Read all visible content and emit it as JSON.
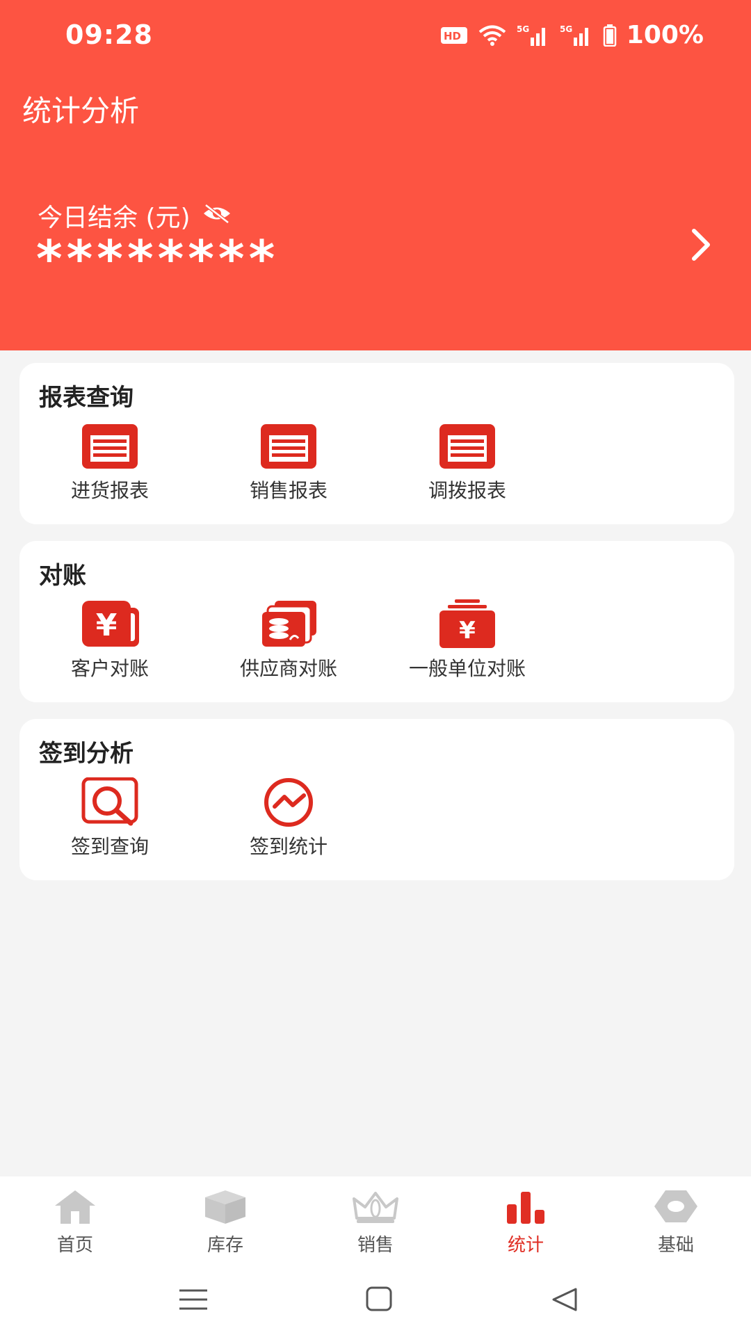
{
  "status": {
    "time": "09:28",
    "battery": "100%",
    "hd": "HD",
    "net1": "5G",
    "net2": "5G"
  },
  "header": {
    "title": "统计分析",
    "balance_label": "今日结余 (元)",
    "balance_value": "********"
  },
  "reports": {
    "title": "报表查询",
    "items": [
      {
        "label": "进货报表",
        "icon": "report-icon"
      },
      {
        "label": "销售报表",
        "icon": "report-icon"
      },
      {
        "label": "调拨报表",
        "icon": "report-icon"
      }
    ]
  },
  "reconcile": {
    "title": "对账",
    "items": [
      {
        "label": "客户对账",
        "icon": "yen-wallet-icon"
      },
      {
        "label": "供应商对账",
        "icon": "coins-icon"
      },
      {
        "label": "一般单位对账",
        "icon": "yen-stack-icon"
      }
    ]
  },
  "checkin": {
    "title": "签到分析",
    "items": [
      {
        "label": "签到查询",
        "icon": "magnifier-icon"
      },
      {
        "label": "签到统计",
        "icon": "trend-icon"
      }
    ]
  },
  "tabs": [
    {
      "label": "首页",
      "icon": "home-icon"
    },
    {
      "label": "库存",
      "icon": "box-icon"
    },
    {
      "label": "销售",
      "icon": "crown-icon"
    },
    {
      "label": "统计",
      "icon": "bar-chart-icon",
      "active": true
    },
    {
      "label": "基础",
      "icon": "hexagon-icon"
    }
  ],
  "colors": {
    "header": "#fd5442",
    "accent": "#e02e24",
    "inactive": "#c8c8c8"
  }
}
